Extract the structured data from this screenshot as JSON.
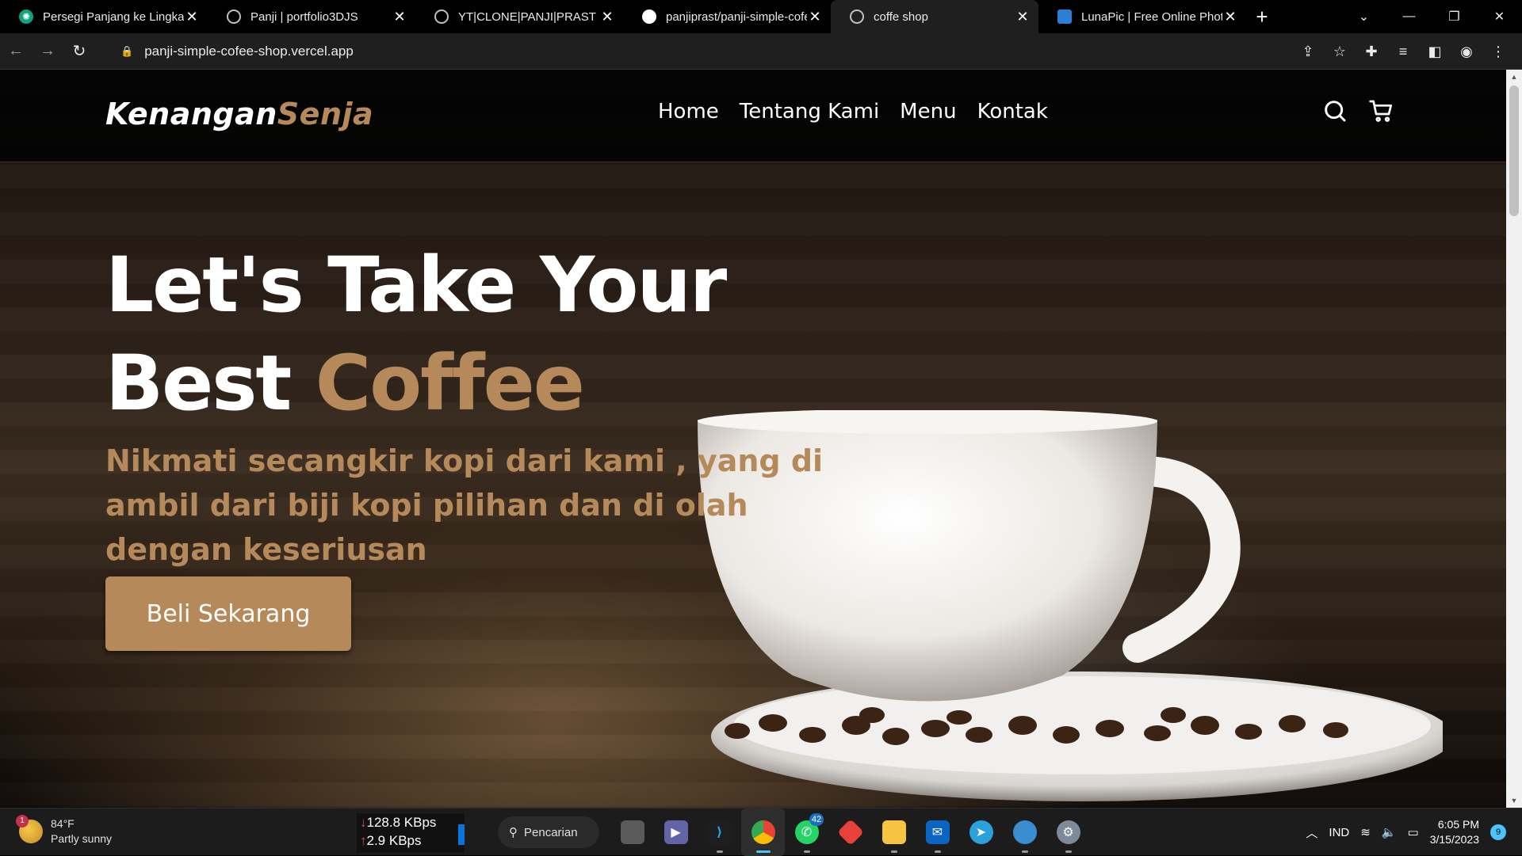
{
  "browser": {
    "tabs": [
      {
        "title": "Persegi Panjang ke Lingkaran",
        "icon": "chatgpt-icon",
        "active": false
      },
      {
        "title": "Panji | portfolio3DJS",
        "icon": "globe-icon",
        "active": false
      },
      {
        "title": "YT|CLONE|PANJI|PRAST",
        "icon": "globe-icon",
        "active": false
      },
      {
        "title": "panjiprast/panji-simple-cofee-shop",
        "icon": "github-icon",
        "active": false
      },
      {
        "title": "coffe shop",
        "icon": "globe-icon",
        "active": true
      },
      {
        "title": "LunaPic | Free Online Photo Editor",
        "icon": "lunapic-icon",
        "active": false
      }
    ],
    "new_tab_label": "+",
    "url": "panji-simple-cofee-shop.vercel.app"
  },
  "site": {
    "logo_main": "Kenangan",
    "logo_accent": "Senja",
    "nav": [
      "Home",
      "Tentang Kami",
      "Menu",
      "Kontak"
    ],
    "hero_line1": "Let's Take Your",
    "hero_line2_plain": "Best ",
    "hero_line2_accent": "Coffee",
    "hero_text": "Nikmati secangkir kopi dari kami , yang di ambil dari biji kopi pilihan dan di olah dengan keseriusan",
    "cta_label": "Beli Sekarang",
    "accent_color": "#b6895b"
  },
  "taskbar": {
    "weather_temp": "84°F",
    "weather_desc": "Partly sunny",
    "weather_badge": "1",
    "net_down": "128.8 KBps",
    "net_up": "2.9 KBps",
    "search_label": "Pencarian",
    "whatsapp_badge": "42",
    "language": "IND",
    "time": "6:05 PM",
    "date": "3/15/2023",
    "notifications": "9"
  }
}
